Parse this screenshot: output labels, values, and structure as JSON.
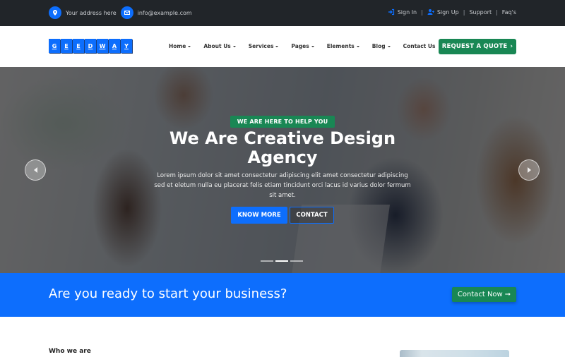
{
  "topbar": {
    "address": "Your address here",
    "email": "info@example.com",
    "links": [
      {
        "label": "Sign In",
        "icon": "sign-in-icon"
      },
      {
        "label": "Sign Up",
        "icon": "user-plus-icon"
      },
      {
        "label": "Support"
      },
      {
        "label": "Faq's"
      }
    ],
    "separator": "|"
  },
  "navbar": {
    "logo_letters": [
      "G",
      "E",
      "E",
      "D",
      "W",
      "A",
      "Y"
    ],
    "menu": [
      {
        "label": "Home",
        "dropdown": true
      },
      {
        "label": "About Us",
        "dropdown": true
      },
      {
        "label": "Services",
        "dropdown": true
      },
      {
        "label": "Pages",
        "dropdown": true
      },
      {
        "label": "Elements",
        "dropdown": true
      },
      {
        "label": "Blog",
        "dropdown": true
      },
      {
        "label": "Contact Us",
        "dropdown": false
      }
    ],
    "cta_label": "REQUEST A QUOTE",
    "cta_icon": "chevron-right-icon"
  },
  "hero": {
    "tag": "WE ARE HERE TO HELP YOU",
    "title": "We Are Creative Design Agency",
    "description": "Lorem ipsum dolor sit amet consectetur adipiscing elit amet consectetur adipiscing sed et eletum nulla eu placerat felis etiam tincidunt orci lacus id varius dolor fermum sit amet.",
    "primary_button": "KNOW MORE",
    "secondary_button": "CONTACT",
    "slides": 3,
    "active_slide": 2
  },
  "cta": {
    "text": "Are you ready to start your business?",
    "button": "Contact Now",
    "button_icon": "arrow-right-icon"
  },
  "below": {
    "heading": "Who we are"
  },
  "colors": {
    "primary": "#0d6efd",
    "success": "#198754",
    "dark": "#212529"
  }
}
